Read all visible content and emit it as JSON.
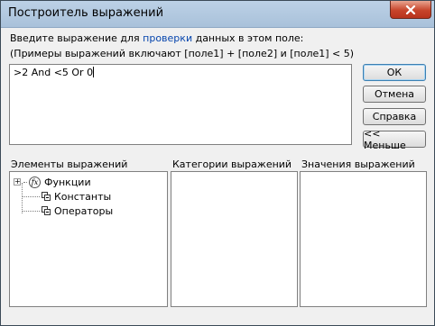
{
  "window": {
    "title": "Построитель выражений"
  },
  "instructions": {
    "line1_prefix": "Введите выражение для ",
    "line1_link": "проверки",
    "line1_suffix": " данных в этом поле:",
    "line2": "(Примеры выражений включают [поле1] + [поле2] и [поле1] < 5)"
  },
  "expression": {
    "value": ">2 And <5 Or 0"
  },
  "buttons": {
    "ok": "ОК",
    "cancel": "Отмена",
    "help": "Справка",
    "less": "<< Меньше"
  },
  "panels": {
    "elements_label": "Элементы выражений",
    "categories_label": "Категории выражений",
    "values_label": "Значения выражений",
    "tree": [
      {
        "label": "Функции",
        "icon": "function-icon",
        "expander": "+"
      },
      {
        "label": "Константы",
        "icon": "constants-icon"
      },
      {
        "label": "Операторы",
        "icon": "operators-icon"
      }
    ]
  }
}
